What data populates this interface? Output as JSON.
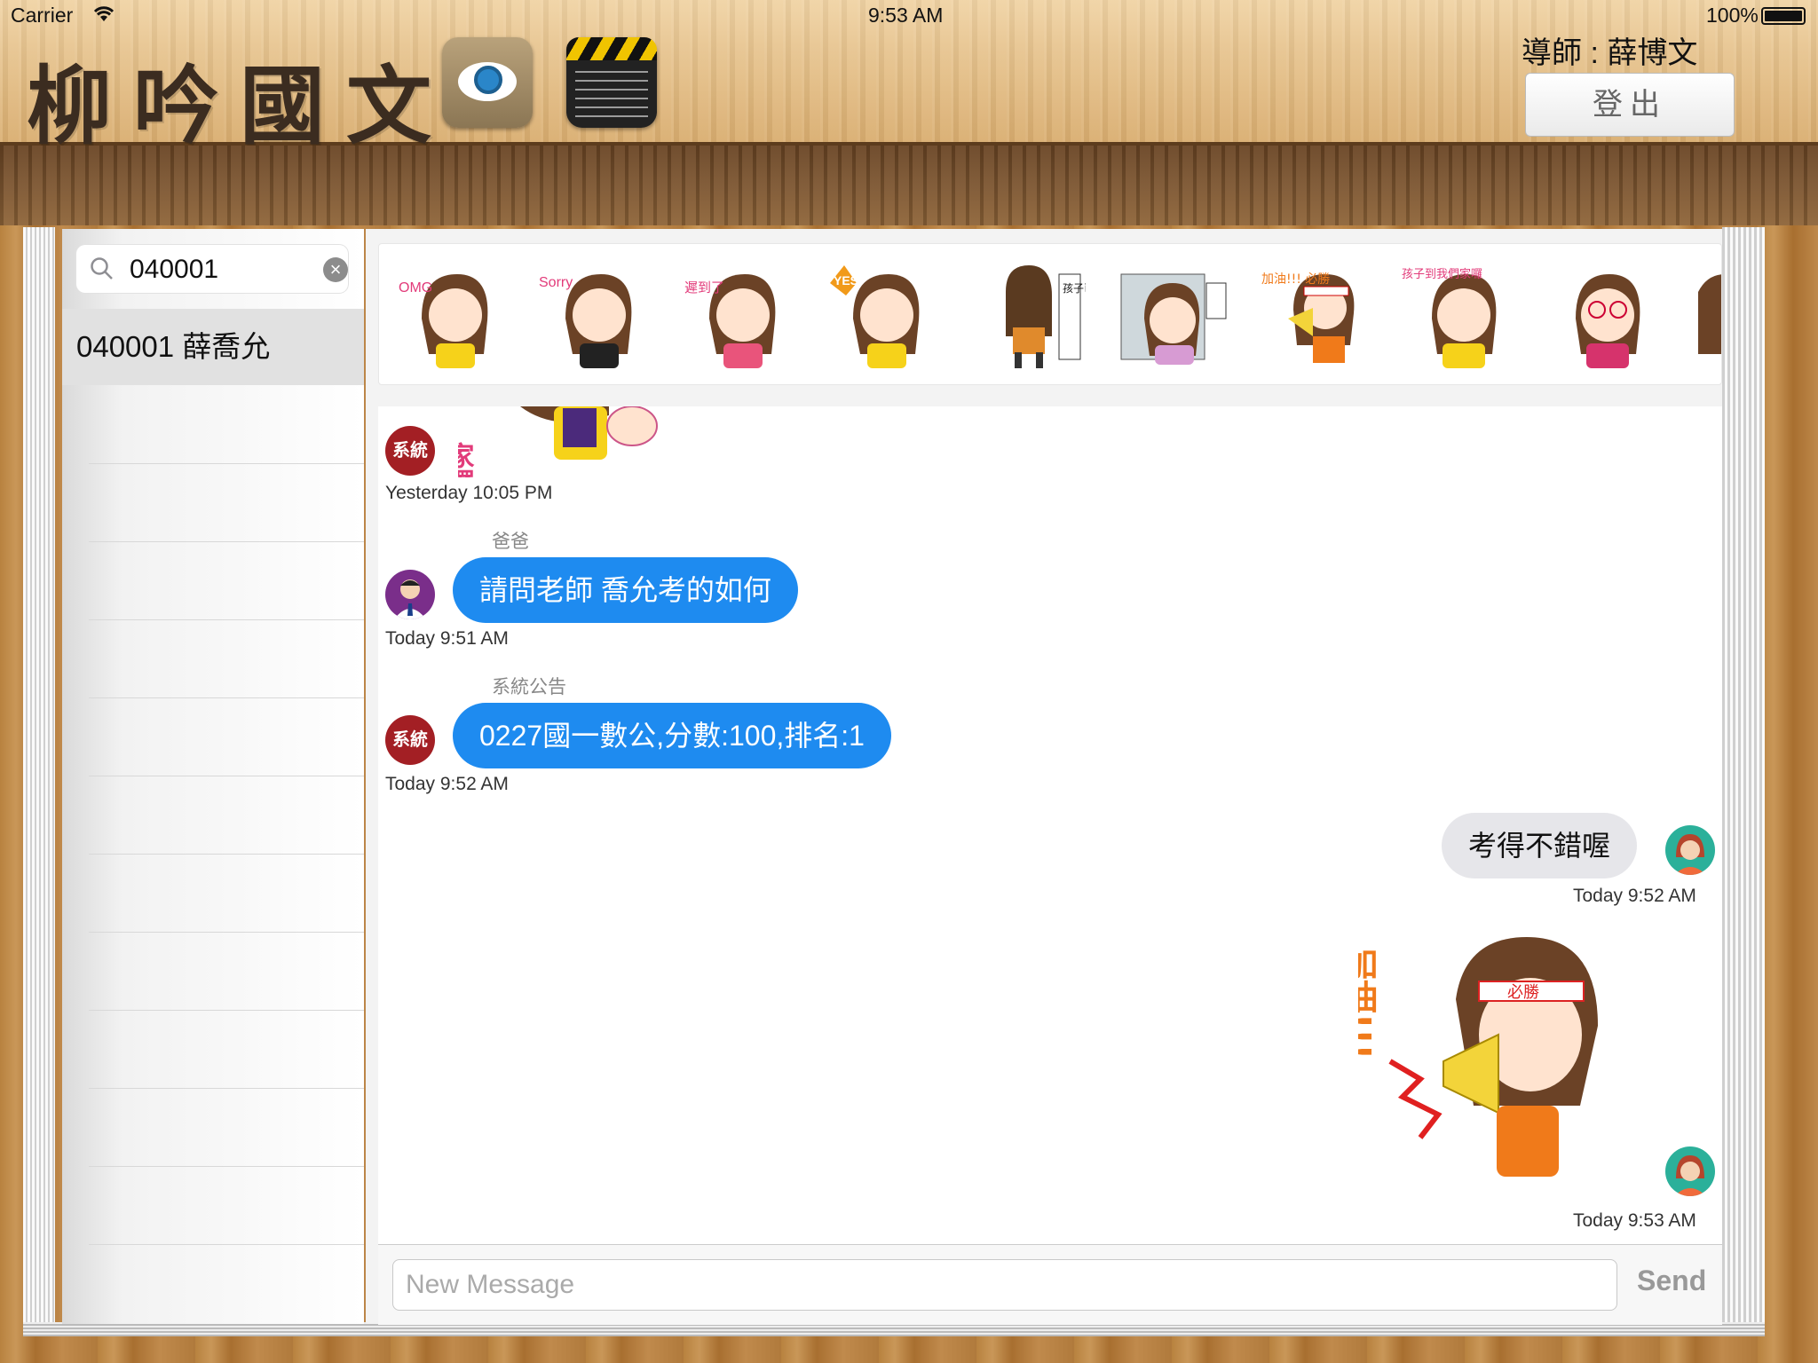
{
  "status_bar": {
    "carrier": "Carrier",
    "time": "9:53 AM",
    "battery": "100%"
  },
  "header": {
    "logo_text": "柳吟國文",
    "apps": [
      {
        "icon": "eye-icon"
      },
      {
        "icon": "clapperboard-icon"
      }
    ],
    "mentor_label": "導師 : 薛博文",
    "logout_label": "登出"
  },
  "sidebar": {
    "search": {
      "value": "040001",
      "placeholder": ""
    },
    "students": [
      {
        "label": "040001 薛喬允"
      }
    ]
  },
  "stickers": {
    "items": [
      {
        "caption": "OMG"
      },
      {
        "caption": "Sorry"
      },
      {
        "caption": "遲到了"
      },
      {
        "caption": "YES"
      },
      {
        "caption": "孩子已離班。"
      },
      {
        "caption": ""
      },
      {
        "caption": "加油!!! 必勝"
      },
      {
        "caption": "孩子到我們家囉"
      },
      {
        "caption": ""
      }
    ]
  },
  "chat": {
    "messages": [
      {
        "type": "sticker",
        "avatar_text": "系統",
        "sticker_caption": "家囉",
        "time": "Yesterday 10:05 PM"
      },
      {
        "type": "text",
        "sender": "爸爸",
        "text": "請問老師 喬允考的如何",
        "time": "Today 9:51 AM"
      },
      {
        "type": "text",
        "sender": "系統公告",
        "avatar_text": "系統",
        "text": "0227國一數公,分數:100,排名:1",
        "time": "Today 9:52 AM"
      },
      {
        "type": "text",
        "sender": "",
        "text": "考得不錯喔",
        "time": "Today 9:52 AM",
        "outgoing": true
      },
      {
        "type": "sticker",
        "sender": "",
        "sticker_caption": "加油!!!",
        "sticker_band": "必勝",
        "time": "Today 9:53 AM",
        "outgoing": true
      }
    ]
  },
  "composer": {
    "placeholder": "New Message",
    "send_label": "Send"
  },
  "colors": {
    "bubble_blue": "#1e8bf0",
    "bubble_gray": "#e6e6ea",
    "system_red": "#a31f24"
  }
}
